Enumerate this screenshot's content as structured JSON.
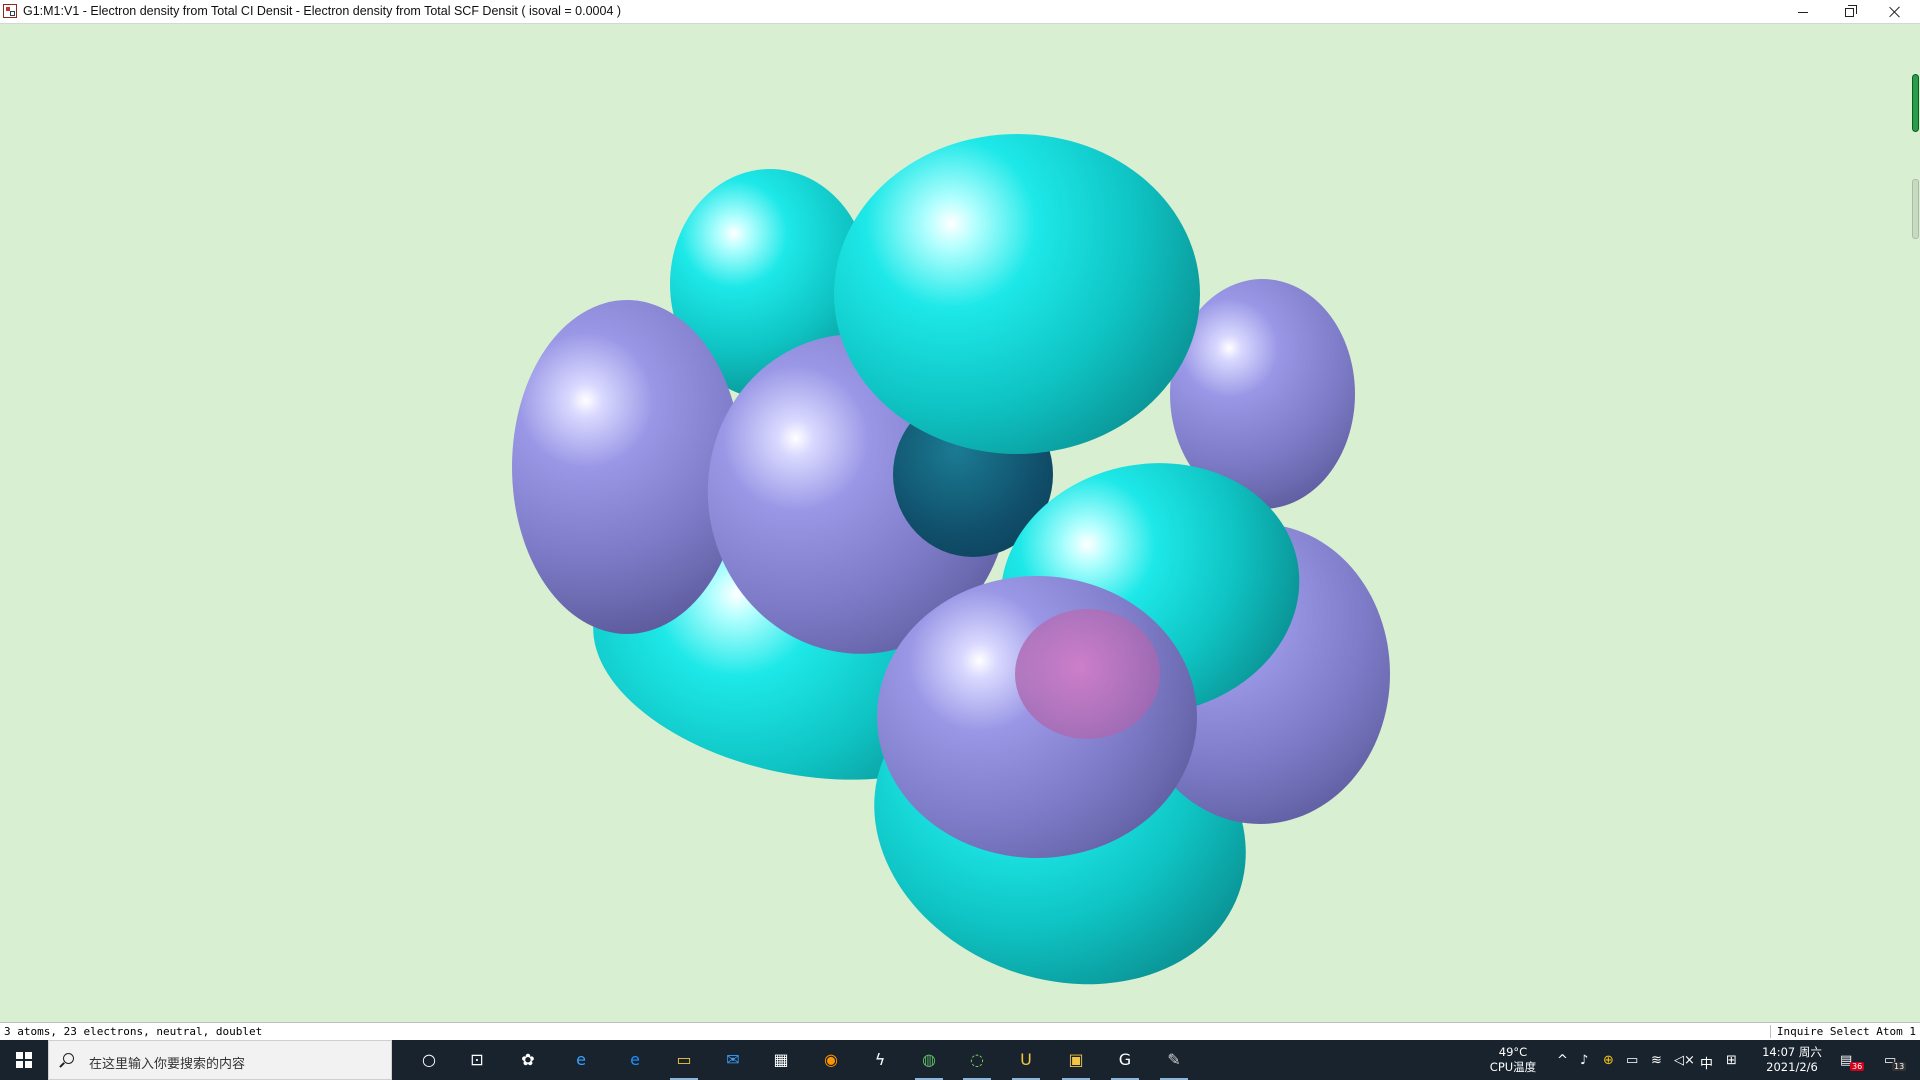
{
  "window": {
    "title": "G1:M1:V1 - Electron density from Total CI Densit -  Electron density from Total SCF Densit ( isoval = 0.0004 )"
  },
  "viewport": {
    "background_color": "#d9efd2",
    "positive_lobe_color": "#11d6d6",
    "negative_lobe_color": "#8a88d8"
  },
  "statusbar": {
    "left_text": "3 atoms, 23 electrons, neutral, doublet",
    "right_text": "Inquire Select Atom 1"
  },
  "taskbar": {
    "search_placeholder": "在这里输入你要搜索的内容",
    "pinned_apps": [
      {
        "name": "cortana-icon",
        "glyph": "○"
      },
      {
        "name": "task-view-icon",
        "glyph": "⊡"
      },
      {
        "name": "app-360-icon",
        "glyph": "✿"
      },
      {
        "name": "ie-icon",
        "glyph": "e"
      },
      {
        "name": "edge-icon",
        "glyph": "e"
      },
      {
        "name": "file-explorer-icon",
        "glyph": "▭"
      },
      {
        "name": "mail-icon",
        "glyph": "✉"
      },
      {
        "name": "store-icon",
        "glyph": "▦"
      },
      {
        "name": "firefox-icon",
        "glyph": "◉"
      },
      {
        "name": "bolt-app-icon",
        "glyph": "ϟ"
      },
      {
        "name": "browser-360-icon",
        "glyph": "◍"
      },
      {
        "name": "wechat-icon",
        "glyph": "◌"
      },
      {
        "name": "uc-icon",
        "glyph": "U"
      },
      {
        "name": "folder-app-icon",
        "glyph": "▣"
      },
      {
        "name": "gaussview-icon",
        "glyph": "G"
      },
      {
        "name": "gaussview-window-icon",
        "glyph": "✎"
      }
    ],
    "temperature": "49°C",
    "temperature_label": "CPU温度",
    "input_method": "中",
    "time": "14:07 周六",
    "date": "2021/2/6",
    "notification_count": "36",
    "action_center_count": "13"
  }
}
